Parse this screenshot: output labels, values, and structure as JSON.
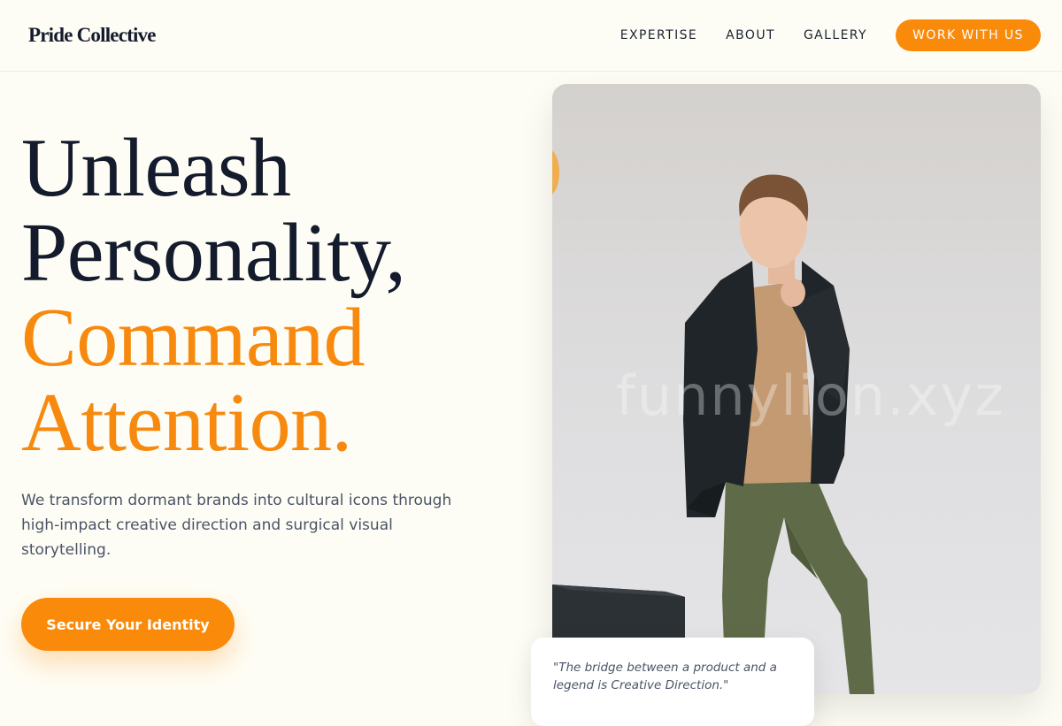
{
  "brand": {
    "name": "Pride Collective"
  },
  "nav": {
    "links": [
      "EXPERTISE",
      "ABOUT",
      "GALLERY"
    ],
    "cta_label": "WORK WITH US"
  },
  "hero": {
    "headline_line1": "Unleash",
    "headline_line2": "Personality,",
    "headline_line3": "Command",
    "headline_line4": "Attention.",
    "description": "We transform dormant brands into cultural icons through high-impact creative direction and surgical visual storytelling.",
    "cta_label": "Secure Your Identity"
  },
  "image": {
    "watermark": "funnylion.xyz"
  },
  "quote": {
    "text": "\"The bridge between a product and a legend is Creative Direction.\""
  },
  "colors": {
    "accent": "#fa8a0a",
    "heading": "#141b2d",
    "background": "#fefdf5",
    "body_text": "#4a5366"
  },
  "icons": []
}
